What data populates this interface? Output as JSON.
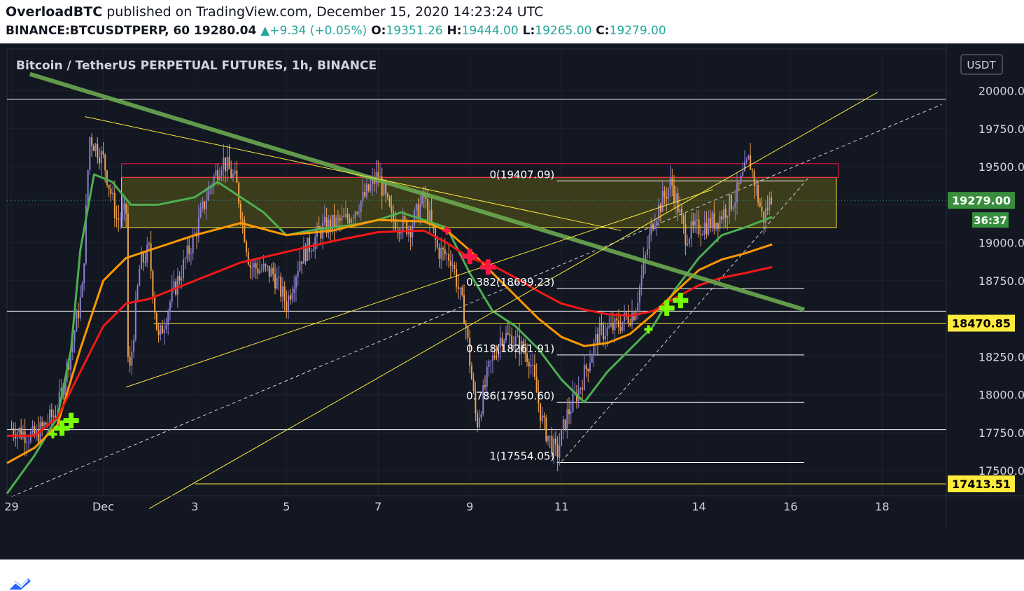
{
  "header": {
    "author": "OverloadBTC",
    "published_text": "published on TradingView.com, December 15, 2020 14:23:24 UTC",
    "symbol": "BINANCE:BTCUSDTPERP, 60",
    "last": "19280.04",
    "change_arrow": "▲",
    "change": "+9.34 (+0.05%)",
    "o_label": "O:",
    "o": "19351.26",
    "h_label": "H:",
    "h": "19444.00",
    "l_label": "L:",
    "l": "19265.00",
    "c_label": "C:",
    "c": "19279.00"
  },
  "footer": {
    "brand": "TradingView",
    "logo_icon": "tradingview-logo-icon"
  },
  "colors": {
    "background": "#131722",
    "grid": "#1e222d",
    "axis_text": "#d1d4dc",
    "ema_fast": "#4caf50",
    "ema_mid": "#ff9800",
    "ema_slow": "#f21818",
    "trendline": "#6aa84f",
    "fib": "#ffffff",
    "yellow": "#ffeb3b",
    "zone_fill": "#4a4a1a",
    "zone_red": "#ff1744",
    "candle_up": "#8b7fcf",
    "candle_down": "#f0a04b",
    "buy_signal": "#76ff03",
    "sell_signal": "#ff1744",
    "price_tag": "#388e3c"
  },
  "chart_data": {
    "type": "candlestick",
    "title": "Bitcoin / TetherUS PERPETUAL FUTURES, 1h, BINANCE",
    "currency": "USDT",
    "ylim": [
      17335,
      20275
    ],
    "y_ticks": [
      17500,
      17750,
      18000,
      18250,
      18500,
      18750,
      19000,
      19250,
      19500,
      19750,
      20000
    ],
    "y_tick_labels": [
      "17500.00",
      "17750.00",
      "18000.00",
      "18250.00",
      "",
      "18750.00",
      "19000.00",
      "",
      "19500.00",
      "19750.00",
      "20000.00"
    ],
    "x_range_days": [
      -1.1,
      19.4
    ],
    "x_ticks": [
      {
        "day": -1,
        "label": "29"
      },
      {
        "day": 1,
        "label": "Dec"
      },
      {
        "day": 3,
        "label": "3"
      },
      {
        "day": 5,
        "label": "5"
      },
      {
        "day": 7,
        "label": "7"
      },
      {
        "day": 9,
        "label": "9"
      },
      {
        "day": 11,
        "label": "11"
      },
      {
        "day": 14,
        "label": "14"
      },
      {
        "day": 16,
        "label": "16"
      },
      {
        "day": 18,
        "label": "18"
      }
    ],
    "price_path": [
      [
        -1.0,
        17780
      ],
      [
        -0.5,
        17720
      ],
      [
        0.0,
        17900
      ],
      [
        0.3,
        18300
      ],
      [
        0.55,
        18700
      ],
      [
        0.7,
        19700
      ],
      [
        1.0,
        19550
      ],
      [
        1.3,
        19150
      ],
      [
        1.5,
        19200
      ],
      [
        1.55,
        18050
      ],
      [
        1.8,
        18850
      ],
      [
        2.0,
        18950
      ],
      [
        2.2,
        18350
      ],
      [
        2.5,
        18650
      ],
      [
        3.0,
        19050
      ],
      [
        3.3,
        19350
      ],
      [
        3.6,
        19550
      ],
      [
        3.9,
        19400
      ],
      [
        4.2,
        18850
      ],
      [
        4.7,
        18800
      ],
      [
        5.0,
        18600
      ],
      [
        5.3,
        18900
      ],
      [
        5.8,
        19100
      ],
      [
        6.3,
        19150
      ],
      [
        6.7,
        19300
      ],
      [
        7.0,
        19450
      ],
      [
        7.3,
        19150
      ],
      [
        7.7,
        19100
      ],
      [
        8.0,
        19300
      ],
      [
        8.3,
        18950
      ],
      [
        8.6,
        18900
      ],
      [
        8.9,
        18500
      ],
      [
        9.15,
        17800
      ],
      [
        9.4,
        18150
      ],
      [
        9.7,
        18400
      ],
      [
        10.0,
        18350
      ],
      [
        10.3,
        18250
      ],
      [
        10.6,
        17800
      ],
      [
        10.9,
        17600
      ],
      [
        11.1,
        17850
      ],
      [
        11.4,
        18050
      ],
      [
        11.8,
        18400
      ],
      [
        12.2,
        18450
      ],
      [
        12.6,
        18550
      ],
      [
        13.0,
        19150
      ],
      [
        13.4,
        19400
      ],
      [
        13.7,
        19050
      ],
      [
        14.0,
        19100
      ],
      [
        14.4,
        19150
      ],
      [
        14.8,
        19300
      ],
      [
        15.1,
        19550
      ],
      [
        15.4,
        19150
      ],
      [
        15.6,
        19320
      ]
    ],
    "series": [
      {
        "name": "",
        "color_key": "ema_fast",
        "points": [
          [
            -1.1,
            17350
          ],
          [
            -0.5,
            17600
          ],
          [
            0.0,
            17850
          ],
          [
            0.3,
            18300
          ],
          [
            0.5,
            18950
          ],
          [
            0.8,
            19450
          ],
          [
            1.2,
            19400
          ],
          [
            1.6,
            19250
          ],
          [
            2.2,
            19250
          ],
          [
            3.0,
            19300
          ],
          [
            3.5,
            19400
          ],
          [
            4.0,
            19300
          ],
          [
            4.5,
            19200
          ],
          [
            5.0,
            19050
          ],
          [
            5.5,
            19080
          ],
          [
            6.0,
            19100
          ],
          [
            6.5,
            19120
          ],
          [
            7.0,
            19150
          ],
          [
            7.5,
            19200
          ],
          [
            8.0,
            19150
          ],
          [
            8.5,
            19100
          ],
          [
            9.0,
            18800
          ],
          [
            9.5,
            18550
          ],
          [
            10.0,
            18450
          ],
          [
            10.5,
            18300
          ],
          [
            11.0,
            18100
          ],
          [
            11.5,
            17950
          ],
          [
            12.0,
            18150
          ],
          [
            12.5,
            18300
          ],
          [
            13.0,
            18450
          ],
          [
            13.5,
            18700
          ],
          [
            14.0,
            18900
          ],
          [
            14.5,
            19050
          ],
          [
            15.0,
            19100
          ],
          [
            15.6,
            19170
          ]
        ]
      },
      {
        "name": "",
        "color_key": "ema_mid",
        "points": [
          [
            -1.1,
            17550
          ],
          [
            -0.5,
            17650
          ],
          [
            0.0,
            17800
          ],
          [
            0.5,
            18300
          ],
          [
            1.0,
            18750
          ],
          [
            1.5,
            18900
          ],
          [
            2.0,
            18950
          ],
          [
            3.0,
            19050
          ],
          [
            4.0,
            19130
          ],
          [
            5.0,
            19050
          ],
          [
            6.0,
            19080
          ],
          [
            7.0,
            19150
          ],
          [
            8.0,
            19140
          ],
          [
            8.5,
            19080
          ],
          [
            9.0,
            18950
          ],
          [
            9.5,
            18800
          ],
          [
            10.0,
            18650
          ],
          [
            10.5,
            18500
          ],
          [
            11.0,
            18380
          ],
          [
            11.5,
            18320
          ],
          [
            12.0,
            18340
          ],
          [
            12.5,
            18400
          ],
          [
            13.0,
            18530
          ],
          [
            13.5,
            18680
          ],
          [
            14.0,
            18820
          ],
          [
            14.5,
            18890
          ],
          [
            15.0,
            18930
          ],
          [
            15.6,
            18990
          ]
        ]
      },
      {
        "name": "",
        "color_key": "ema_slow",
        "points": [
          [
            -1.1,
            17730
          ],
          [
            -0.5,
            17730
          ],
          [
            0.0,
            17850
          ],
          [
            0.5,
            18150
          ],
          [
            1.0,
            18450
          ],
          [
            1.5,
            18600
          ],
          [
            2.0,
            18630
          ],
          [
            3.0,
            18750
          ],
          [
            4.0,
            18870
          ],
          [
            5.0,
            18940
          ],
          [
            6.0,
            19010
          ],
          [
            7.0,
            19070
          ],
          [
            8.0,
            19080
          ],
          [
            8.5,
            19000
          ],
          [
            9.0,
            18900
          ],
          [
            9.5,
            18850
          ],
          [
            10.0,
            18770
          ],
          [
            10.5,
            18680
          ],
          [
            11.0,
            18600
          ],
          [
            11.5,
            18560
          ],
          [
            12.0,
            18530
          ],
          [
            12.5,
            18520
          ],
          [
            13.0,
            18550
          ],
          [
            13.5,
            18640
          ],
          [
            14.0,
            18720
          ],
          [
            14.5,
            18770
          ],
          [
            15.0,
            18800
          ],
          [
            15.6,
            18840
          ]
        ]
      }
    ],
    "fib_levels": [
      {
        "label": "0(19407.09)",
        "value": 19407.09
      },
      {
        "label": "0.382(18699.23)",
        "value": 18699.23
      },
      {
        "label": "0.618(18261.91)",
        "value": 18261.91
      },
      {
        "label": "0.786(17950.60)",
        "value": 17950.6
      },
      {
        "label": "1(17554.05)",
        "value": 17554.05
      }
    ],
    "horizontal_levels": [
      19945,
      18550,
      17770
    ],
    "yellow_levels": [
      {
        "value": 18470.85,
        "label": "18470.85"
      },
      {
        "value": 17413.51,
        "label": "17413.51"
      }
    ],
    "zone": {
      "low": 19100,
      "high": 19430
    },
    "resistance_box": {
      "low": 19430,
      "high": 19520
    },
    "trendlines": [
      {
        "kind": "thick",
        "from": [
          -0.6,
          20110
        ],
        "to": [
          16.3,
          18560
        ]
      },
      {
        "kind": "thin",
        "from": [
          0.6,
          19830
        ],
        "to": [
          12.3,
          19080
        ]
      },
      {
        "kind": "thin",
        "from": [
          1.5,
          18050
        ],
        "to": [
          14.3,
          19350
        ]
      },
      {
        "kind": "thin",
        "from": [
          2.0,
          17250
        ],
        "to": [
          17.9,
          19990
        ]
      }
    ],
    "dashed_channel": [
      {
        "from": [
          -1.0,
          17330
        ],
        "to": [
          19.3,
          19910
        ]
      },
      {
        "from": [
          11.0,
          17560
        ],
        "to": [
          16.4,
          19430
        ]
      }
    ],
    "buy_signals": [
      {
        "day": -0.1,
        "value": 17740,
        "size": "small"
      },
      {
        "day": 0.1,
        "value": 17780,
        "size": "large"
      },
      {
        "day": 0.3,
        "value": 17830,
        "size": "large"
      },
      {
        "day": 12.9,
        "value": 18430,
        "size": "small"
      },
      {
        "day": 13.3,
        "value": 18570,
        "size": "large"
      },
      {
        "day": 13.6,
        "value": 18620,
        "size": "large"
      }
    ],
    "sell_signals": [
      {
        "day": 8.5,
        "value": 19080,
        "size": "small"
      },
      {
        "day": 9.0,
        "value": 18910,
        "size": "large"
      },
      {
        "day": 9.4,
        "value": 18840,
        "size": "large"
      }
    ],
    "last_price": {
      "value": 19279,
      "label": "19279.00",
      "countdown": "36:37"
    }
  }
}
